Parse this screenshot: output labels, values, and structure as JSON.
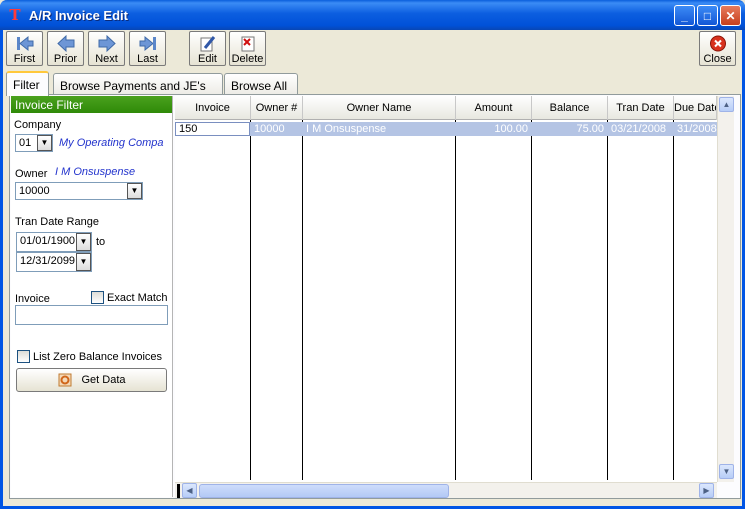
{
  "window": {
    "title": "A/R Invoice Edit"
  },
  "toolbar": {
    "first": "First",
    "prior": "Prior",
    "next": "Next",
    "last": "Last",
    "edit": "Edit",
    "delete": "Delete",
    "close": "Close"
  },
  "tabs": [
    "Filter",
    "Browse Payments and JE's",
    "Browse All"
  ],
  "filter": {
    "header": "Invoice Filter",
    "company_label": "Company",
    "company_value": "01",
    "company_name": "My Operating Compa",
    "owner_label": "Owner",
    "owner_name": "I M Onsuspense",
    "owner_value": "10000",
    "tran_date_label": "Tran Date Range",
    "date_from": "01/01/1900",
    "to_label": "to",
    "date_to": "12/31/2099",
    "invoice_label": "Invoice",
    "exact_match_label": "Exact Match",
    "zero_balance_label": "List Zero Balance Invoices",
    "get_data_label": "Get Data"
  },
  "grid": {
    "columns": [
      "Invoice",
      "Owner #",
      "Owner Name",
      "Amount",
      "Balance",
      "Tran Date",
      "Due Date"
    ],
    "rows": [
      {
        "invoice": "150",
        "owner_num": "10000",
        "owner_name": "I M Onsuspense",
        "amount": "100.00",
        "balance": "75.00",
        "tran_date": "03/21/2008",
        "due_date": "31/2008"
      }
    ]
  },
  "colors": {
    "title_bar": "#0055e5",
    "filter_header": "#3a9412",
    "selected_row": "#b4c4e4",
    "accent_tab": "#ffc83c"
  }
}
